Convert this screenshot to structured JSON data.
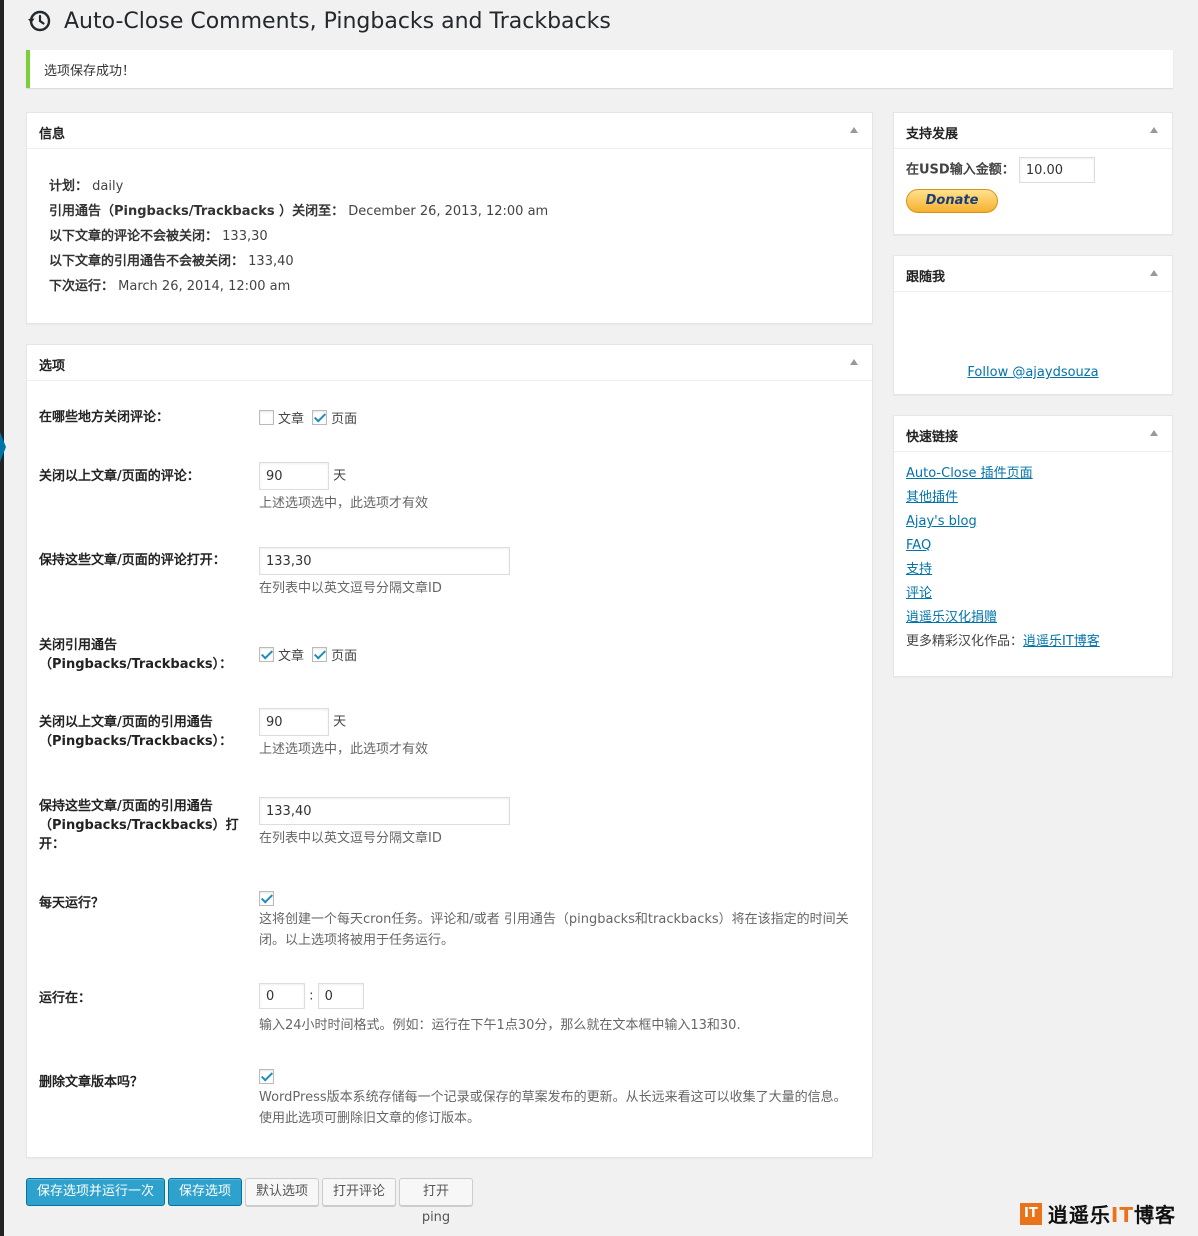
{
  "page": {
    "title": "Auto-Close Comments, Pingbacks and Trackbacks",
    "notice": "选项保存成功！"
  },
  "info_box": {
    "title": "信息",
    "rows": [
      {
        "label": "计划：",
        "value": "daily"
      },
      {
        "label": "引用通告（Pingbacks/Trackbacks ）关闭至：",
        "value": "December 26, 2013, 12:00 am"
      },
      {
        "label": "以下文章的评论不会被关闭：",
        "value": "133,30"
      },
      {
        "label": "以下文章的引用通告不会被关闭：",
        "value": "133,40"
      },
      {
        "label": "下次运行：",
        "value": "March 26, 2014, 12:00 am"
      }
    ]
  },
  "options_box": {
    "title": "选项",
    "close_where": {
      "label": "在哪些地方关闭评论：",
      "post_label": "文章",
      "page_label": "页面",
      "post_checked": false,
      "page_checked": true
    },
    "close_after": {
      "label": "关闭以上文章/页面的评论：",
      "value": "90",
      "unit": "天",
      "desc": "上述选项选中，此选项才有效"
    },
    "keep_open": {
      "label": "保持这些文章/页面的评论打开：",
      "value": "133,30",
      "desc": "在列表中以英文逗号分隔文章ID"
    },
    "close_pings": {
      "label": "关闭引用通告（Pingbacks/Trackbacks）：",
      "post_label": "文章",
      "page_label": "页面",
      "post_checked": true,
      "page_checked": true
    },
    "close_pings_after": {
      "label": "关闭以上文章/页面的引用通告（Pingbacks/Trackbacks）：",
      "value": "90",
      "unit": "天",
      "desc": "上述选项选中，此选项才有效"
    },
    "keep_pings_open": {
      "label": "保持这些文章/页面的引用通告（Pingbacks/Trackbacks）打开：",
      "value": "133,40",
      "desc": "在列表中以英文逗号分隔文章ID"
    },
    "daily": {
      "label": "每天运行？",
      "checked": true,
      "desc": "这将创建一个每天cron任务。评论和/或者 引用通告（pingbacks和trackbacks）将在该指定的时间关闭。以上选项将被用于任务运行。"
    },
    "run_at": {
      "label": "运行在：",
      "hour": "0",
      "sep": ":",
      "minute": "0",
      "desc": "输入24小时时间格式。例如：运行在下午1点30分，那么就在文本框中输入13和30."
    },
    "delete_revisions": {
      "label": "删除文章版本吗？",
      "checked": true,
      "desc": "WordPress版本系统存储每一个记录或保存的草案发布的更新。从长远来看这可以收集了大量的信息。使用此选项可删除旧文章的修订版本。"
    }
  },
  "support_box": {
    "title": "支持发展",
    "amount_label": "在USD输入金额：",
    "amount_value": "10.00",
    "donate_label": "Donate"
  },
  "follow_box": {
    "title": "跟随我",
    "link": "Follow @ajaydsouza"
  },
  "links_box": {
    "title": "快速链接",
    "links": [
      "Auto-Close 插件页面",
      "其他插件",
      "Ajay's blog",
      "FAQ",
      "支持",
      "评论",
      "逍遥乐汉化捐赠"
    ],
    "more_label": "更多精彩汉化作品：",
    "more_link": "逍遥乐IT博客"
  },
  "buttons": {
    "save_run": "保存选项并运行一次",
    "save": "保存选项",
    "defaults": "默认选项",
    "open_comments": "打开评论",
    "open_pings": "打开ping"
  },
  "watermark": {
    "logo": "IT",
    "text_a": "逍遥乐",
    "text_it": "IT",
    "text_b": "博客"
  },
  "colors": {
    "accent": "#0073aa",
    "primary_button": "#2ea2cc",
    "notice_border": "#7ad03a",
    "watermark": "#e8731b"
  },
  "icons": {
    "title_icon": "history-clock-icon",
    "toggle": "triangle-up-icon",
    "checkbox": "checkmark-icon"
  }
}
